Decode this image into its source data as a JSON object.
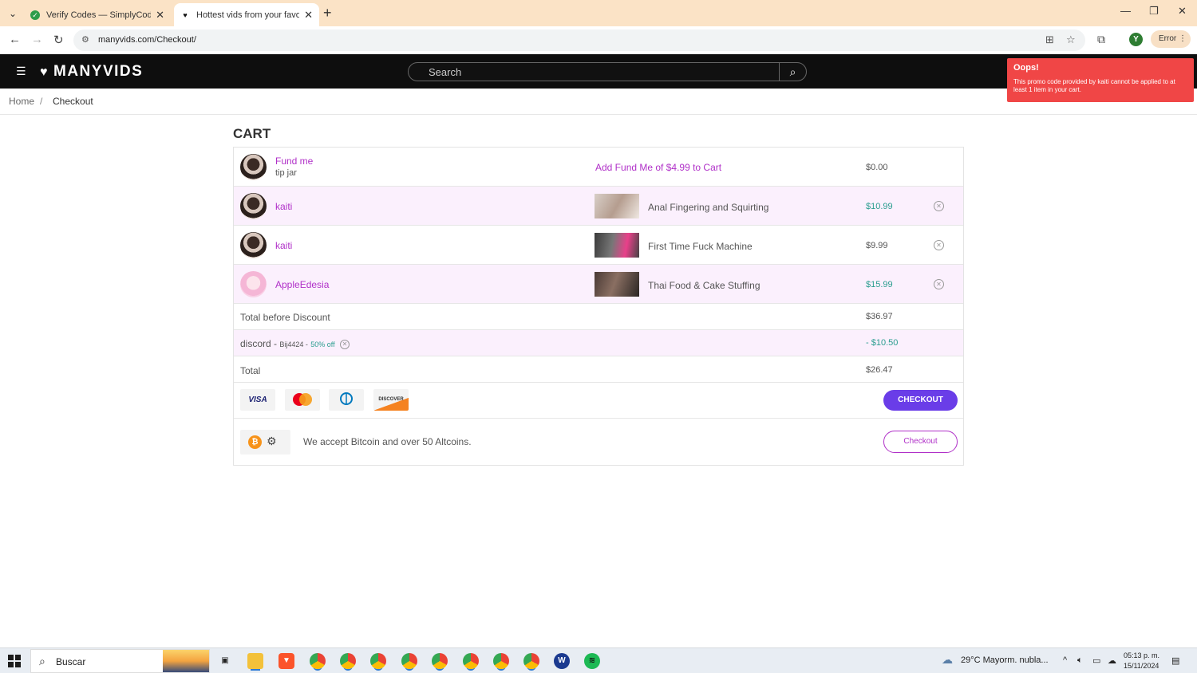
{
  "browser": {
    "tabs": [
      {
        "title": "Verify Codes — SimplyCodes",
        "active": false
      },
      {
        "title": "Hottest vids from your favorite",
        "active": true
      }
    ],
    "new_tab_label": "+",
    "url": "manyvids.com/Checkout/",
    "error_label": "Error",
    "profile_initial": "Y"
  },
  "site": {
    "logo_text": "MANYVIDS",
    "search_placeholder": "Search"
  },
  "toast": {
    "title": "Oops!",
    "message": "This promo code provided by kaiti cannot be applied to at least 1 item in your cart."
  },
  "breadcrumb": {
    "home": "Home",
    "separator": "/",
    "current": "Checkout"
  },
  "cart": {
    "title": "CART",
    "fund": {
      "seller": "Fund me",
      "sub": "tip jar",
      "action": "Add Fund Me of $4.99 to Cart",
      "price": "$0.00"
    },
    "items": [
      {
        "seller": "kaiti",
        "product": "Anal Fingering and Squirting",
        "price": "$10.99",
        "highlight": true
      },
      {
        "seller": "kaiti",
        "product": "First Time Fuck Machine",
        "price": "$9.99",
        "highlight": false
      },
      {
        "seller": "AppleEdesia",
        "product": "Thai Food & Cake Stuffing",
        "price": "$15.99",
        "highlight": true
      }
    ],
    "total_before_label": "Total before Discount",
    "total_before": "$36.97",
    "discount_label": "discord -",
    "discount_code": "Bij4424 -",
    "discount_pct": "50% off",
    "discount_amount": "- $10.50",
    "total_label": "Total",
    "total": "$26.47",
    "cards": [
      "VISA",
      "MasterCard",
      "Diners Club",
      "DISCOVER"
    ],
    "checkout_label": "CHECKOUT",
    "crypto_text": "We accept Bitcoin and over 50 Altcoins.",
    "crypto_checkout_label": "Checkout"
  },
  "taskbar": {
    "search_placeholder": "Buscar",
    "weather": "29°C  Mayorm. nubla...",
    "time": "05:13 p. m.",
    "date": "15/11/2024"
  },
  "colors": {
    "accent_purple": "#b030c8",
    "checkout_button": "#6a3de8",
    "price_teal": "#2a9d8f",
    "toast_red": "#f04646",
    "row_pink": "#fbf0fd"
  }
}
